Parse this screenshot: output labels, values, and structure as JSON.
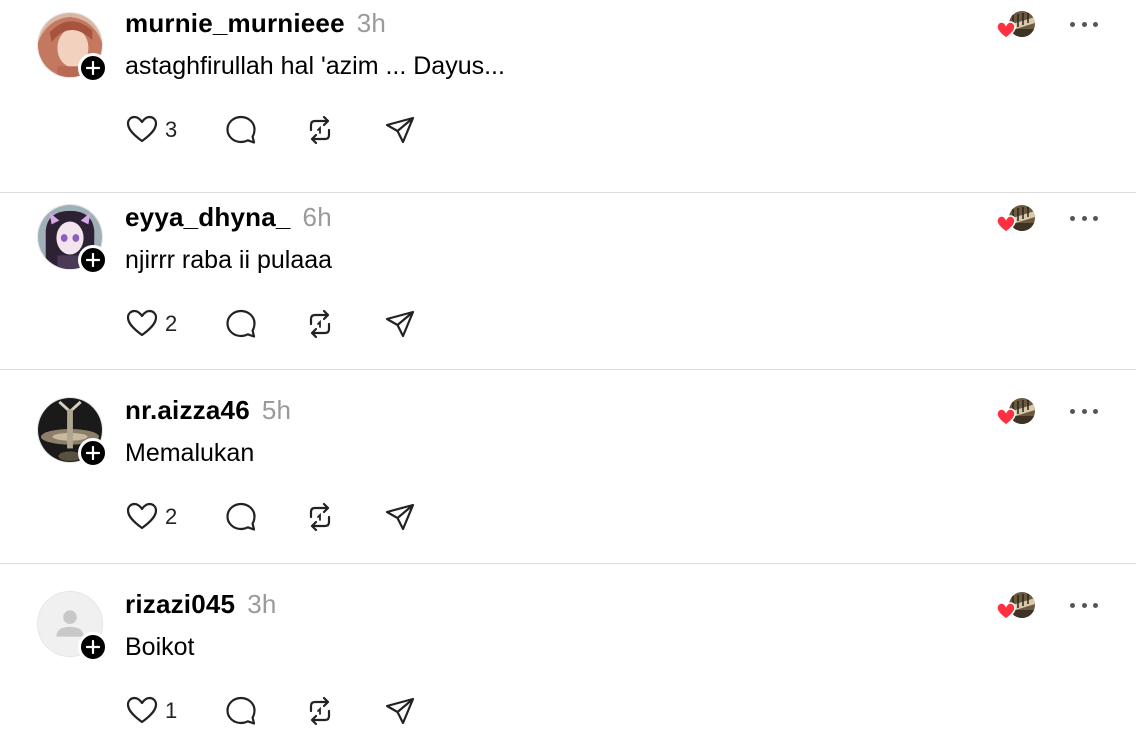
{
  "colors": {
    "divider": "#dcdcdc",
    "timestamp": "#9a9a9a",
    "heart": "#ff3040"
  },
  "posts": [
    {
      "username": "murnie_murnieee",
      "time": "3h",
      "text": "astaghfirullah hal 'azim ... Dayus...",
      "likes": "3",
      "avatar": "hijab-photo"
    },
    {
      "username": "eyya_dhyna_",
      "time": "6h",
      "text": "njirrr raba ii pulaaa",
      "likes": "2",
      "avatar": "anime-character"
    },
    {
      "username": "nr.aizza46",
      "time": "5h",
      "text": "Memalukan",
      "likes": "2",
      "avatar": "dark-photo"
    },
    {
      "username": "rizazi045",
      "time": "3h",
      "text": "Boikot",
      "likes": "1",
      "avatar": "default-person"
    }
  ],
  "icons": {
    "like": "heart-outline-icon",
    "reply": "speech-bubble-icon",
    "repost": "repost-arrows-icon",
    "share": "paper-plane-icon",
    "follow": "plus-icon",
    "more": "ellipsis-icon"
  }
}
